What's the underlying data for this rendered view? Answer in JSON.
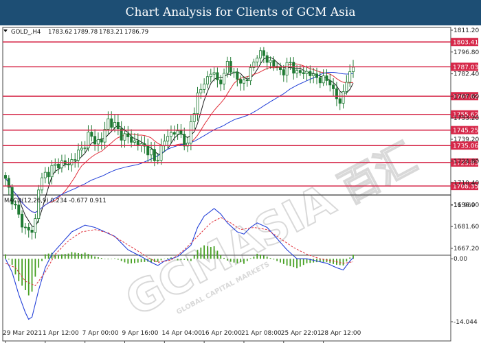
{
  "title": "Chart Analysis for Clients of GCM Asia",
  "colors": {
    "banner": "#1d4e74",
    "level_line": "#d6294a",
    "candle": "#1f7a33",
    "ma_fast": "#1a1a1a",
    "ma_mid": "#e0303a",
    "ma_slow": "#2340d8",
    "macd_line": "#2340d8",
    "signal_line": "#e0303a",
    "histogram": "#46a022"
  },
  "watermark": {
    "text": "GCMASIA",
    "chinese": "百汇",
    "tagline": "GLOBAL CAPITAL MARKETS"
  },
  "chart_data": [
    {
      "type": "candlestick",
      "title": "",
      "header": {
        "symbol": "GOLD_,H4",
        "open": "1783.62",
        "high": "1789.78",
        "low": "1783.21",
        "close": "1786.79"
      },
      "ylim": [
        1667.2,
        1811.2
      ],
      "yticks": [
        "1811.20",
        "1796.80",
        "1782.40",
        "1767.60",
        "1753.20",
        "1739.20",
        "1724.80",
        "1710.40",
        "1696.00",
        "1681.60",
        "1667.20"
      ],
      "xticks": [
        "29 Mar 2021",
        "1 Apr 12:00",
        "7 Apr 00:00",
        "9 Apr 16:00",
        "14 Apr 04:00",
        "16 Apr 20:00",
        "21 Apr 08:00",
        "25 Apr 22:01",
        "28 Apr 12:00"
      ],
      "levels": [
        {
          "value": 1803.41,
          "label": "1803.41"
        },
        {
          "value": 1787.03,
          "label": "1787.03"
        },
        {
          "value": 1767.62,
          "label": "1767.62"
        },
        {
          "value": 1755.62,
          "label": "1755.62"
        },
        {
          "value": 1745.25,
          "label": "1745.25"
        },
        {
          "value": 1735.06,
          "label": "1735.06"
        },
        {
          "value": 1723.83,
          "label": "1723.83"
        },
        {
          "value": 1708.35,
          "label": "1708.35"
        }
      ],
      "close_anchors": [
        [
          0,
          1712
        ],
        [
          4,
          1688
        ],
        [
          6,
          1680
        ],
        [
          8,
          1678
        ],
        [
          9,
          1686
        ],
        [
          10,
          1708
        ],
        [
          12,
          1716
        ],
        [
          14,
          1720
        ],
        [
          17,
          1724
        ],
        [
          19,
          1722
        ],
        [
          21,
          1728
        ],
        [
          23,
          1732
        ],
        [
          25,
          1742
        ],
        [
          27,
          1738
        ],
        [
          29,
          1738
        ],
        [
          31,
          1752
        ],
        [
          33,
          1748
        ],
        [
          35,
          1742
        ],
        [
          37,
          1740
        ],
        [
          40,
          1736
        ],
        [
          42,
          1734
        ],
        [
          44,
          1730
        ],
        [
          45,
          1724
        ],
        [
          47,
          1733
        ],
        [
          49,
          1742
        ],
        [
          51,
          1744
        ],
        [
          53,
          1742
        ],
        [
          55,
          1734
        ],
        [
          56,
          1750
        ],
        [
          58,
          1768
        ],
        [
          60,
          1776
        ],
        [
          62,
          1784
        ],
        [
          64,
          1778
        ],
        [
          66,
          1780
        ],
        [
          67,
          1790
        ],
        [
          69,
          1782
        ],
        [
          71,
          1776
        ],
        [
          73,
          1780
        ],
        [
          74,
          1784
        ],
        [
          76,
          1796
        ],
        [
          78,
          1794
        ],
        [
          80,
          1790
        ],
        [
          82,
          1786
        ],
        [
          84,
          1784
        ],
        [
          86,
          1790
        ],
        [
          88,
          1782
        ],
        [
          90,
          1784
        ],
        [
          92,
          1782
        ],
        [
          94,
          1780
        ],
        [
          96,
          1778
        ],
        [
          98,
          1778
        ],
        [
          99,
          1770
        ],
        [
          100,
          1766
        ],
        [
          101,
          1764
        ],
        [
          102,
          1770
        ],
        [
          103,
          1778
        ],
        [
          104,
          1782
        ],
        [
          105,
          1786.79
        ]
      ]
    },
    {
      "type": "macd",
      "title": "",
      "header": "MACD(12,26,9) 0.234 -0.677 0.911",
      "yticks": [
        "11.969",
        "0.00",
        "-14.044"
      ],
      "ylim": [
        -14.044,
        11.969
      ],
      "macd_anchors": [
        [
          0,
          0
        ],
        [
          2,
          -3
        ],
        [
          4,
          -8
        ],
        [
          6,
          -12
        ],
        [
          7,
          -13.5
        ],
        [
          8,
          -13
        ],
        [
          10,
          -7
        ],
        [
          12,
          -2
        ],
        [
          14,
          1
        ],
        [
          17,
          3.5
        ],
        [
          20,
          6
        ],
        [
          24,
          7.5
        ],
        [
          27,
          7
        ],
        [
          30,
          6
        ],
        [
          33,
          5
        ],
        [
          37,
          2
        ],
        [
          41,
          0.5
        ],
        [
          44,
          -0.8
        ],
        [
          46,
          -1.5
        ],
        [
          48,
          -0.5
        ],
        [
          52,
          0.5
        ],
        [
          56,
          3
        ],
        [
          58,
          7
        ],
        [
          60,
          9.5
        ],
        [
          63,
          11.2
        ],
        [
          65,
          10
        ],
        [
          67,
          8
        ],
        [
          70,
          6
        ],
        [
          72,
          5.5
        ],
        [
          74,
          7
        ],
        [
          76,
          8
        ],
        [
          79,
          7
        ],
        [
          82,
          4.5
        ],
        [
          85,
          2
        ],
        [
          88,
          0
        ],
        [
          91,
          0
        ],
        [
          94,
          -0.5
        ],
        [
          97,
          -1
        ],
        [
          100,
          -2
        ],
        [
          102,
          -2.5
        ],
        [
          104,
          -0.5
        ],
        [
          105,
          0.234
        ]
      ],
      "signal_anchors": [
        [
          0,
          -1
        ],
        [
          3,
          -2
        ],
        [
          6,
          -5
        ],
        [
          9,
          -6
        ],
        [
          12,
          -3
        ],
        [
          15,
          1
        ],
        [
          19,
          4
        ],
        [
          23,
          6
        ],
        [
          27,
          6.5
        ],
        [
          31,
          5.8
        ],
        [
          35,
          4
        ],
        [
          39,
          2.2
        ],
        [
          43,
          0.3
        ],
        [
          46,
          -0.8
        ],
        [
          50,
          -0.3
        ],
        [
          54,
          2
        ],
        [
          58,
          5
        ],
        [
          62,
          8
        ],
        [
          65,
          9.2
        ],
        [
          68,
          8
        ],
        [
          71,
          6.5
        ],
        [
          75,
          7
        ],
        [
          79,
          6.5
        ],
        [
          83,
          4.5
        ],
        [
          87,
          2.5
        ],
        [
          91,
          1
        ],
        [
          95,
          0
        ],
        [
          99,
          -0.5
        ],
        [
          102,
          -1
        ],
        [
          105,
          -0.677
        ]
      ]
    }
  ]
}
